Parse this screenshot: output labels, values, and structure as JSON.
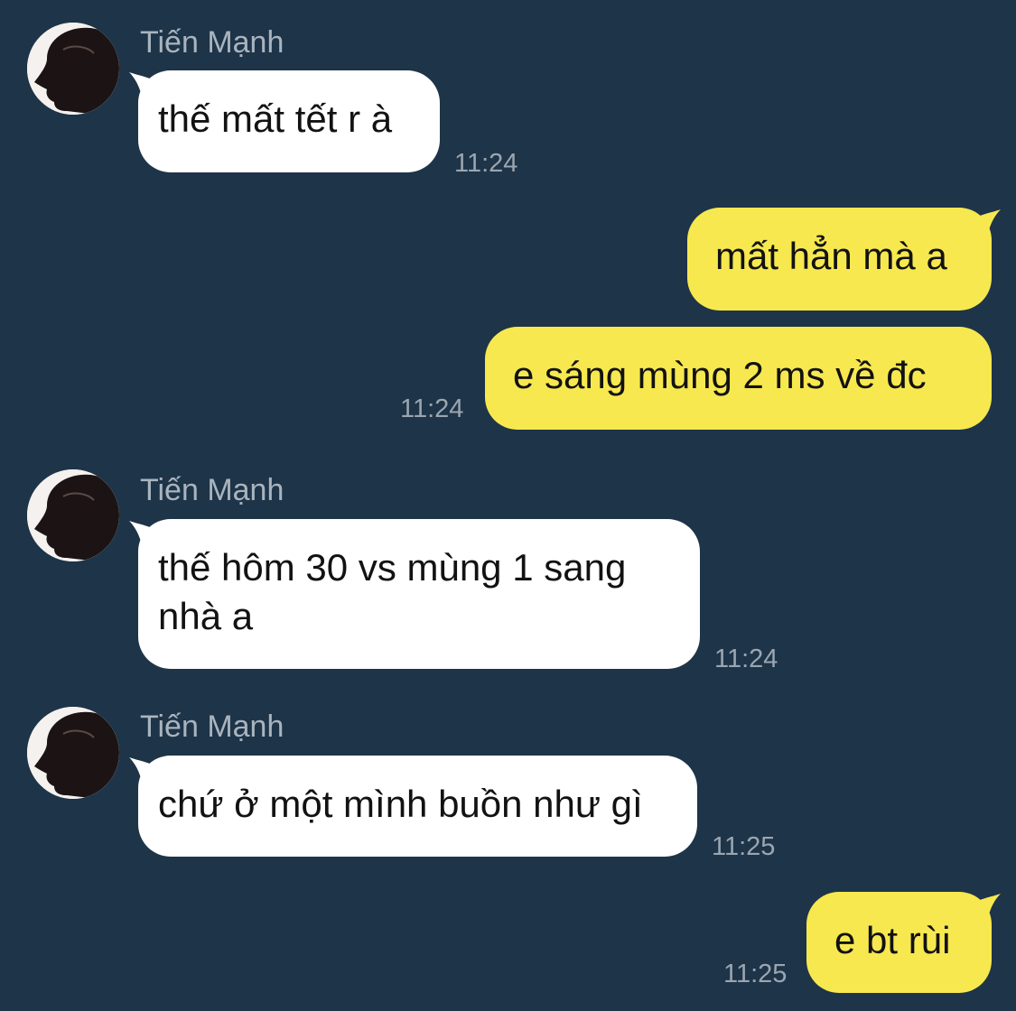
{
  "colors": {
    "background": "#1e3448",
    "incoming_bubble": "#ffffff",
    "outgoing_bubble": "#f7e84f",
    "sender_name": "#a9b4bf",
    "timestamp": "#9aa6b1"
  },
  "messages": [
    {
      "direction": "incoming",
      "sender": "Tiến Mạnh",
      "avatar_icon": "user-avatar-icon",
      "text": "thế mất tết r à",
      "time": "11:24"
    },
    {
      "direction": "outgoing",
      "text": "mất hẳn mà a",
      "time": ""
    },
    {
      "direction": "outgoing",
      "text": "e sáng mùng 2 ms về đc",
      "time": "11:24"
    },
    {
      "direction": "incoming",
      "sender": "Tiến Mạnh",
      "avatar_icon": "user-avatar-icon",
      "text": "thế hôm 30 vs mùng 1 sang\nnhà a",
      "time": "11:24"
    },
    {
      "direction": "incoming",
      "sender": "Tiến Mạnh",
      "avatar_icon": "user-avatar-icon",
      "text": "chứ ở một mình buồn như gì",
      "time": "11:25"
    },
    {
      "direction": "outgoing",
      "text": "e bt rùi",
      "time": "11:25"
    }
  ]
}
